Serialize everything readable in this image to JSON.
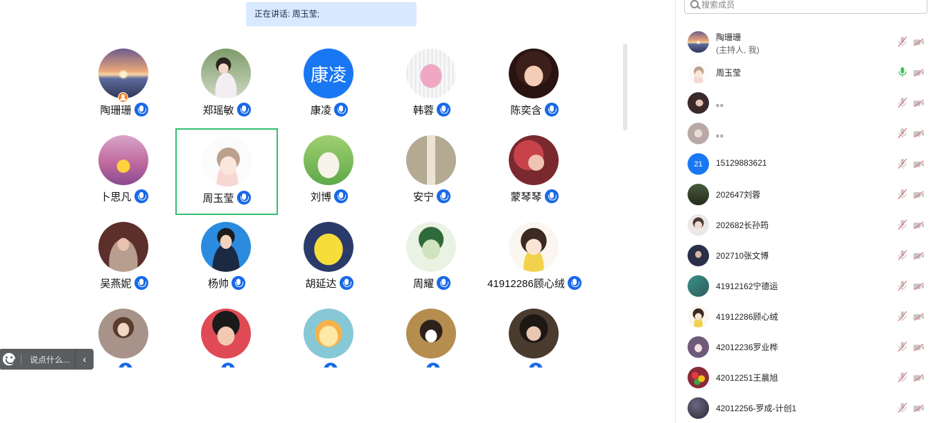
{
  "banner": {
    "speaking": "正在讲话: 周玉莹;"
  },
  "grid": {
    "tiles": [
      {
        "name": "陶珊珊",
        "host": true,
        "av": "sunset-lake"
      },
      {
        "name": "郑瑶敏",
        "av": "girl-flowers"
      },
      {
        "name": "康凌",
        "av": "initials",
        "initials": "康凌"
      },
      {
        "name": "韩蓉",
        "av": "pink-dino"
      },
      {
        "name": "陈奕含",
        "av": "girl-face"
      },
      {
        "name": "卜思凡",
        "av": "purple-sunset"
      },
      {
        "name": "周玉莹",
        "av": "sketch-girl",
        "active": true
      },
      {
        "name": "刘博",
        "av": "cat-green"
      },
      {
        "name": "安宁",
        "av": "beige-figure"
      },
      {
        "name": "蒙琴琴",
        "av": "red-girl"
      },
      {
        "name": "吴燕妮",
        "av": "grandma"
      },
      {
        "name": "杨帅",
        "av": "man-suit"
      },
      {
        "name": "胡延达",
        "av": "pikachu"
      },
      {
        "name": "周耀",
        "av": "green-anime"
      },
      {
        "name": "41912286顾心绒",
        "av": "chibi-cat"
      },
      {
        "name": "",
        "av": "woman-beige"
      },
      {
        "name": "",
        "av": "red-boy"
      },
      {
        "name": "",
        "av": "lion"
      },
      {
        "name": "",
        "av": "girl-mask"
      },
      {
        "name": "",
        "av": "girl-dark"
      }
    ]
  },
  "chat": {
    "placeholder": "说点什么...",
    "collapse_glyph": "‹"
  },
  "panel": {
    "search_placeholder": "搜索成员",
    "participants": [
      {
        "name": "陶珊珊",
        "sub": "(主持人, 我)",
        "av": "sunset-lake",
        "mic": "muted"
      },
      {
        "name": "周玉莹",
        "av": "sketch-girl",
        "mic": "on"
      },
      {
        "name": "。。",
        "av": "dark-photo",
        "mic": "muted"
      },
      {
        "name": "。。",
        "av": "pale-photo",
        "mic": "muted"
      },
      {
        "name": "15129883621",
        "av": "initials",
        "initials": "21",
        "mic": "muted"
      },
      {
        "name": "202647刘蓉",
        "av": "forest",
        "mic": "muted"
      },
      {
        "name": "202682长孙筠",
        "av": "girl-light",
        "mic": "muted"
      },
      {
        "name": "202710张文博",
        "av": "navy-photo",
        "mic": "muted"
      },
      {
        "name": "41912162宁德运",
        "av": "teal-photo",
        "mic": "muted"
      },
      {
        "name": "41912286顾心绒",
        "av": "chibi-cat",
        "mic": "muted"
      },
      {
        "name": "42012236罗业桦",
        "av": "anime-purple",
        "mic": "muted"
      },
      {
        "name": "42012251王晨旭",
        "av": "flowers",
        "mic": "muted"
      },
      {
        "name": "42012256-罗成-计创1",
        "av": "dark-purple",
        "mic": "muted"
      }
    ]
  },
  "colors": {
    "accent": "#1769e8",
    "active_border": "#2fbf71",
    "mic_on": "#3ec35a",
    "muted": "#e0707a"
  }
}
